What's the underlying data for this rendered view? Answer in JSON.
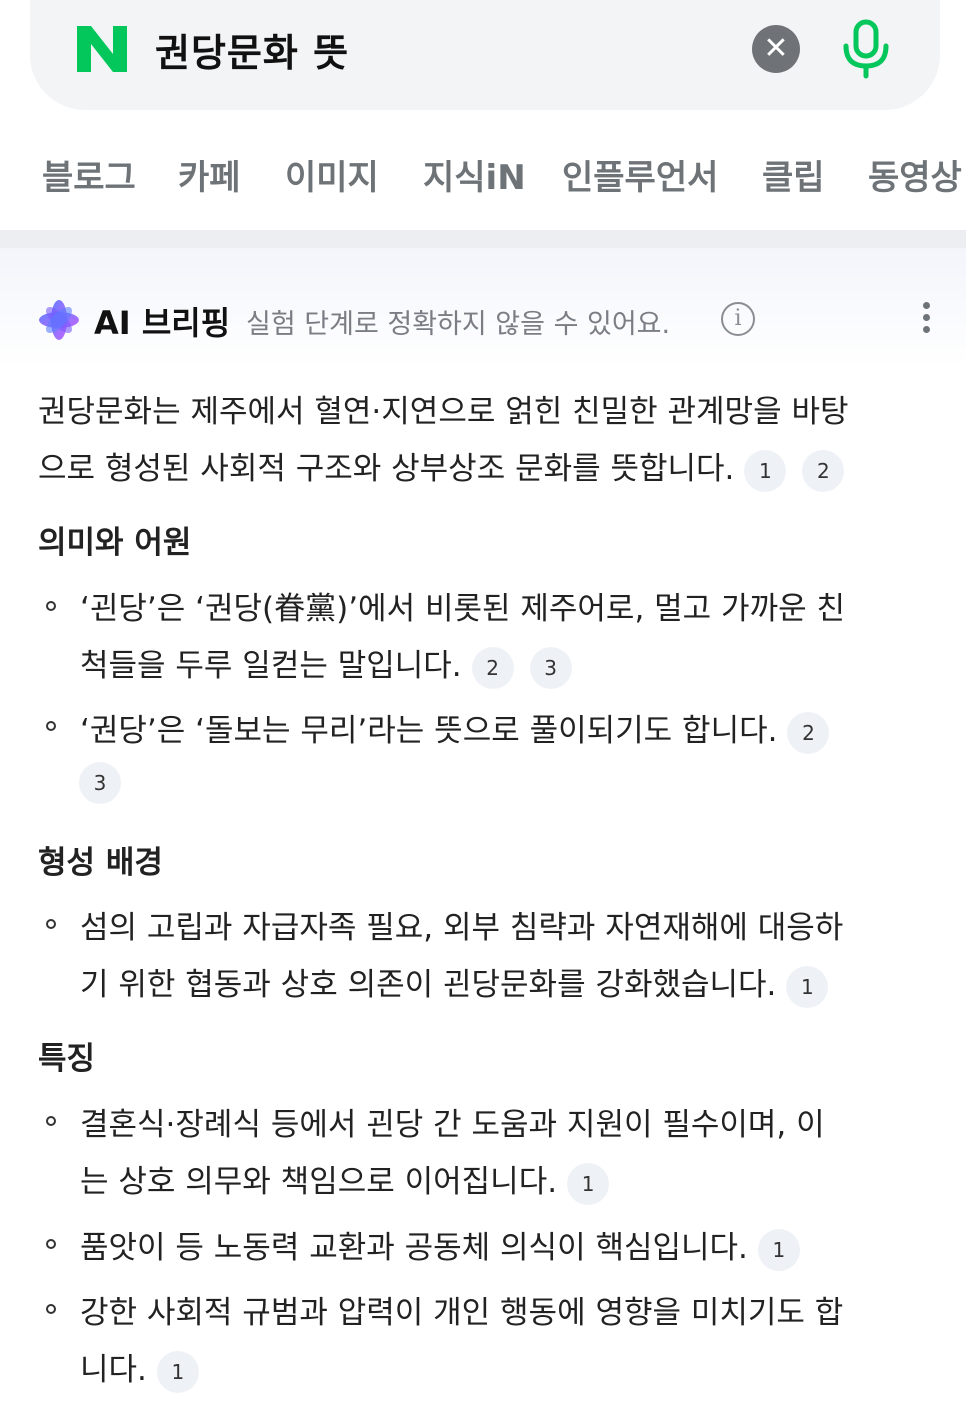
{
  "search": {
    "logo": "N",
    "query": "권당문화 뜻",
    "clear_icon": "✕"
  },
  "tabs": [
    "블로그",
    "카페",
    "이미지",
    "지식iN",
    "인플루언서",
    "클립",
    "동영상"
  ],
  "ai_briefing": {
    "title": "AI 브리핑",
    "note": "실험 단계로 정확하지 않을 수 있어요.",
    "info_icon": "i",
    "summary_line1": "권당문화는 제주에서 혈연·지연으로 얽힌 친밀한 관계망을 바탕",
    "summary_line2": "으로 형성된 사회적 구조와 상부상조 문화를 뜻합니다.",
    "summary_cites": [
      "1",
      "2"
    ],
    "sections": [
      {
        "heading": "의미와 어원",
        "bullets": [
          {
            "line1": "‘괸당’은 ‘권당(眷黨)’에서 비롯된 제주어로, 멀고 가까운 친",
            "line2": "척들을 두루 일컫는 말입니다.",
            "cites": [
              "2",
              "3"
            ]
          },
          {
            "line1": "‘권당’은 ‘돌보는 무리’라는 뜻으로 풀이되기도 합니다.",
            "line2": "",
            "cites": [
              "2",
              "3"
            ]
          }
        ]
      },
      {
        "heading": "형성 배경",
        "bullets": [
          {
            "line1": "섬의 고립과 자급자족 필요, 외부 침략과 자연재해에 대응하",
            "line2": "기 위한 협동과 상호 의존이 괸당문화를 강화했습니다.",
            "cites": [
              "1"
            ]
          }
        ]
      },
      {
        "heading": "특징",
        "bullets": [
          {
            "line1": "결혼식·장례식 등에서 괸당 간 도움과 지원이 필수이며, 이",
            "line2": "는 상호 의무와 책임으로 이어집니다.",
            "cites": [
              "1"
            ]
          },
          {
            "line1": "품앗이 등 노동력 교환과 공동체 의식이 핵심입니다.",
            "line2": "",
            "cites": [
              "1"
            ]
          },
          {
            "line1": "강한 사회적 규범과 압력이 개인 행동에 영향을 미치기도 합",
            "line2": "니다.",
            "cites": [
              "1"
            ]
          }
        ]
      }
    ]
  },
  "colors": {
    "naver_green": "#03c75a",
    "ai_gradient": [
      "#4f6bff",
      "#b44dff"
    ]
  }
}
